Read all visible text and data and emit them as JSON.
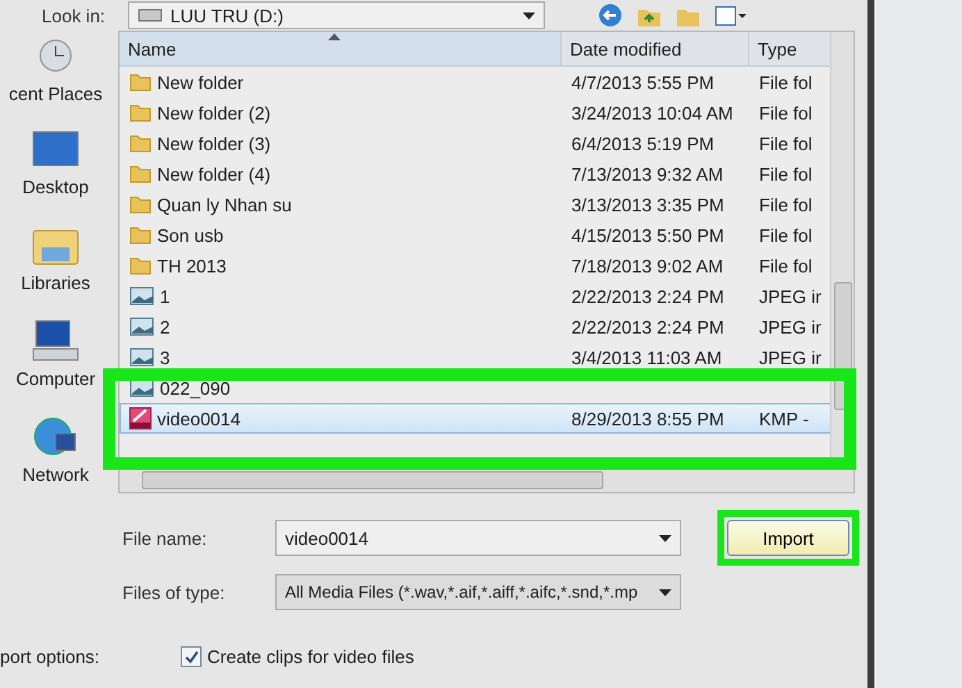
{
  "look_in": {
    "label": "Look in:",
    "value": "LUU TRU (D:)"
  },
  "sidebar": {
    "items": [
      {
        "label": "cent Places",
        "kind": "recent"
      },
      {
        "label": "Desktop",
        "kind": "desktop"
      },
      {
        "label": "Libraries",
        "kind": "libraries"
      },
      {
        "label": "Computer",
        "kind": "computer"
      },
      {
        "label": "Network",
        "kind": "network"
      }
    ]
  },
  "file_list": {
    "columns": [
      {
        "label": "Name",
        "sorted": true
      },
      {
        "label": "Date modified",
        "sorted": false
      },
      {
        "label": "Type",
        "sorted": false
      }
    ],
    "rows": [
      {
        "name": "New folder",
        "date": "4/7/2013 5:55 PM",
        "type": "File fol",
        "kind": "folder",
        "selected": false
      },
      {
        "name": "New folder (2)",
        "date": "3/24/2013 10:04 AM",
        "type": "File fol",
        "kind": "folder",
        "selected": false
      },
      {
        "name": "New folder (3)",
        "date": "6/4/2013 5:19 PM",
        "type": "File fol",
        "kind": "folder",
        "selected": false
      },
      {
        "name": "New folder (4)",
        "date": "7/13/2013 9:32 AM",
        "type": "File fol",
        "kind": "folder",
        "selected": false
      },
      {
        "name": "Quan ly Nhan su",
        "date": "3/13/2013 3:35 PM",
        "type": "File fol",
        "kind": "folder",
        "selected": false
      },
      {
        "name": "Son usb",
        "date": "4/15/2013 5:50 PM",
        "type": "File fol",
        "kind": "folder",
        "selected": false
      },
      {
        "name": "TH 2013",
        "date": "7/18/2013 9:02 AM",
        "type": "File fol",
        "kind": "folder",
        "selected": false
      },
      {
        "name": "1",
        "date": "2/22/2013 2:24 PM",
        "type": "JPEG ir",
        "kind": "image",
        "selected": false
      },
      {
        "name": "2",
        "date": "2/22/2013 2:24 PM",
        "type": "JPEG ir",
        "kind": "image",
        "selected": false
      },
      {
        "name": "3",
        "date": "3/4/2013 11:03 AM",
        "type": "JPEG ir",
        "kind": "image",
        "selected": false
      },
      {
        "name": "022_090",
        "kind": "image",
        "selected": false
      },
      {
        "name": "video0014",
        "date": "8/29/2013 8:55 PM",
        "type": "KMP -",
        "kind": "video",
        "selected": true
      }
    ]
  },
  "file_name": {
    "label": "File name:",
    "value": "video0014"
  },
  "file_type": {
    "label": "Files of type:",
    "value": "All Media Files (*.wav,*.aif,*.aiff,*.aifc,*.snd,*.mp"
  },
  "import_button": "Import",
  "options": {
    "label": "port options:",
    "checkbox": {
      "label": "Create clips for video files",
      "checked": true
    }
  }
}
